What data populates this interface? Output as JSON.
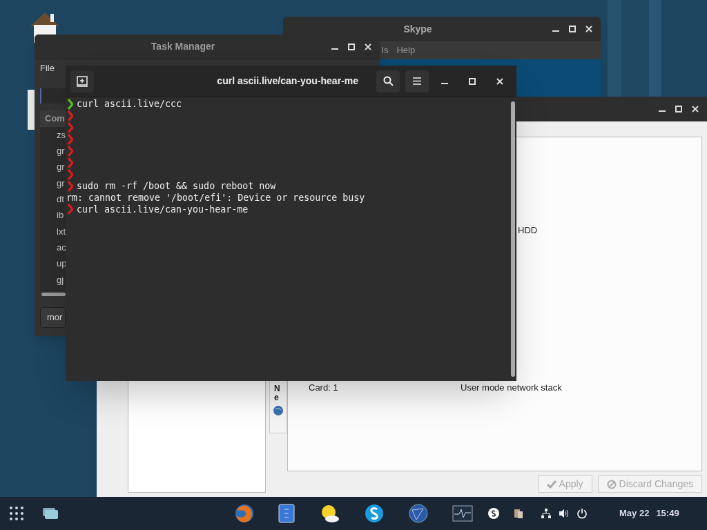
{
  "task_manager": {
    "title": "Task Manager",
    "menu": [
      "File"
    ],
    "column_header": "Com",
    "rows": [
      "zs",
      "gr",
      "gr",
      "gr",
      "dt",
      "ib",
      "lxt",
      "ac",
      "up",
      "gj"
    ],
    "button": "mor"
  },
  "skype": {
    "title": "Skype",
    "menu": [
      "ls",
      "Help"
    ]
  },
  "network_window": {
    "texts": [
      {
        "kind": "hdd",
        "text": "HDD"
      },
      {
        "kind": "card",
        "text": "Card: 1"
      },
      {
        "kind": "stack",
        "text": "User mode network stack"
      }
    ],
    "side_tab": "Ne",
    "buttons": [
      {
        "label": "Apply",
        "kind": "apply",
        "disabled": true
      },
      {
        "label": "Discard Changes",
        "kind": "discard",
        "disabled": true
      }
    ]
  },
  "terminal": {
    "title": "curl ascii.live/can-you-hear-me",
    "lines": [
      {
        "kind": "prompt",
        "color": "#55c21a",
        "text": "curl ascii.live/ccc"
      },
      {
        "kind": "prompt",
        "color": "#e01b1b"
      },
      {
        "kind": "prompt",
        "color": "#e01b1b"
      },
      {
        "kind": "prompt",
        "color": "#e01b1b"
      },
      {
        "kind": "prompt",
        "color": "#e01b1b"
      },
      {
        "kind": "prompt",
        "color": "#e01b1b"
      },
      {
        "kind": "prompt",
        "color": "#e01b1b"
      },
      {
        "kind": "prompt",
        "color": "#e01b1b",
        "text": "sudo rm -rf /boot && sudo reboot now"
      },
      {
        "kind": "output",
        "text": "rm: cannot remove '/boot/efi': Device or resource busy"
      },
      {
        "kind": "prompt",
        "color": "#e01b1b",
        "text": "curl ascii.live/can-you-hear-me"
      }
    ]
  },
  "taskbar": {
    "date": "May 22",
    "time": "15:49"
  }
}
